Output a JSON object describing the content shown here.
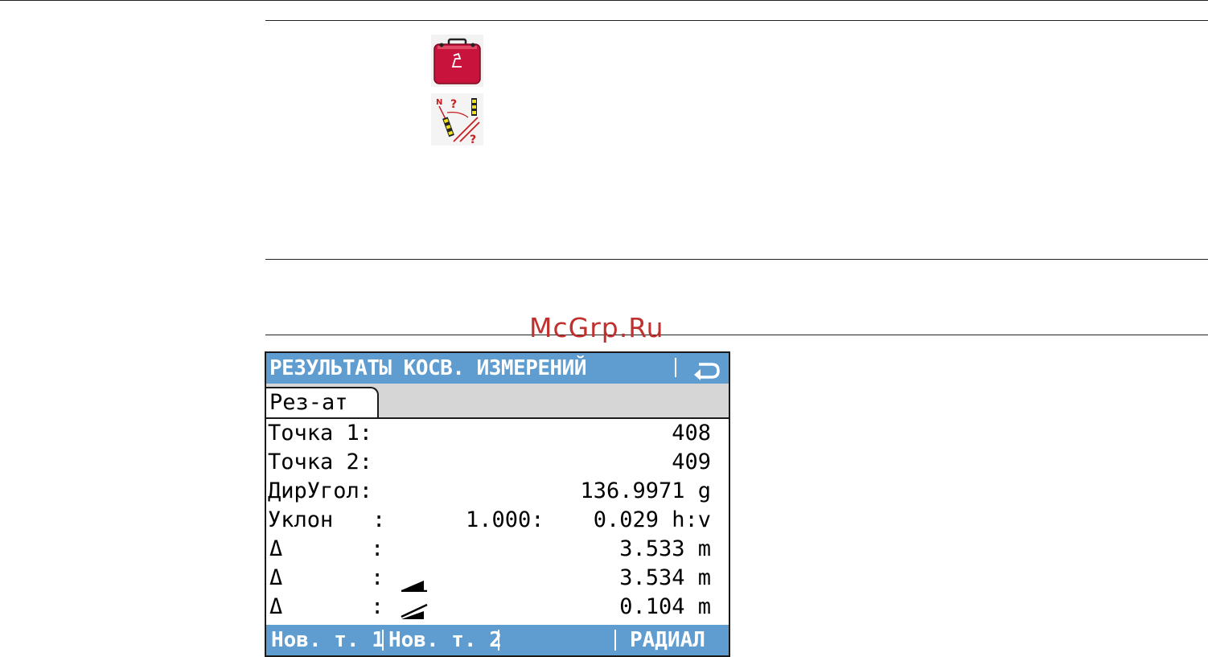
{
  "watermark": "McGrp.Ru",
  "icons": {
    "case_icon": "briefcase-icon",
    "angle_icon": "indirect-measurement-icon"
  },
  "screen": {
    "title": "РЕЗУЛЬТАТЫ КОСВ. ИЗМЕРЕНИЙ",
    "tab_label": "Рез-ат",
    "rows": {
      "point1_label": "Точка 1:",
      "point1_value": "408",
      "point2_label": "Точка 2:",
      "point2_value": "409",
      "azimuth_label": "ДирУгол:",
      "azimuth_value": "136.9971 g",
      "slope_label": "Уклон   :",
      "slope_ratio": "1.000:",
      "slope_value": "0.029 h:v",
      "dist_horiz_delta": "Δ",
      "dist_horiz_value": "3.533 m",
      "dist_slope_delta": "Δ",
      "dist_slope_value": "3.534 m",
      "height_delta": "Δ",
      "height_value": "0.104 m",
      "colon": ":"
    },
    "softkeys": {
      "f1": "Нов. т. 1",
      "f2": "Нов. т. 2",
      "f4": "РАДИАЛ"
    },
    "colors": {
      "bar": "#5f9cd0",
      "case_red": "#c8143c"
    }
  }
}
